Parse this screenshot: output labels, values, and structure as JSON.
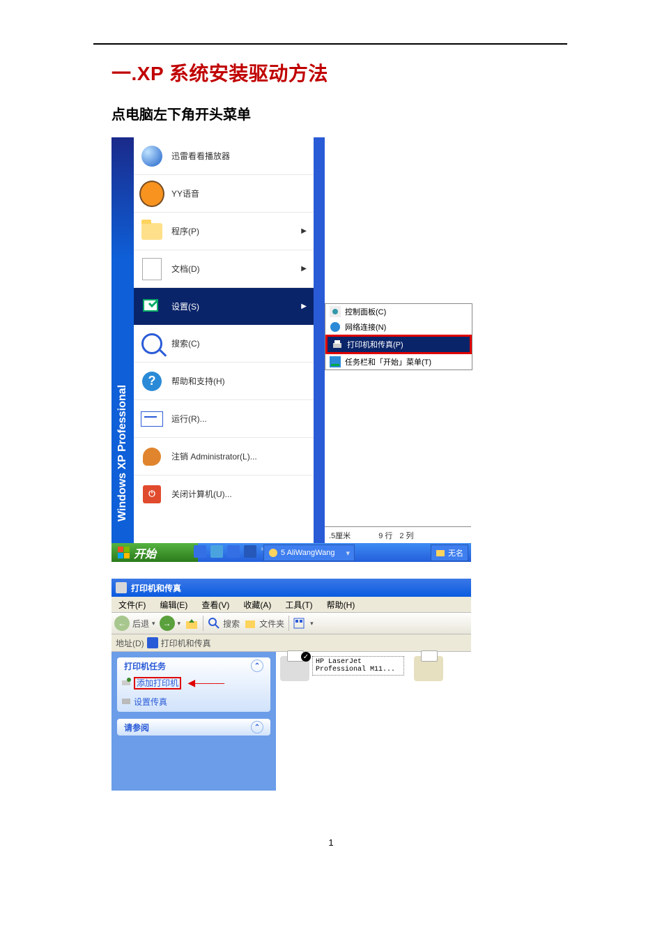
{
  "doc": {
    "title": "一.XP 系统安装驱动方法",
    "subtitle": "点电脑左下角开头菜单",
    "page_number": "1"
  },
  "start_menu": {
    "sidebar_text": "Windows XP  Professional",
    "items": [
      {
        "label": "迅雷看看播放器",
        "icon": "xunlei-icon"
      },
      {
        "label": "YY语音",
        "icon": "yy-icon"
      },
      {
        "label": "程序(P)",
        "icon": "programs-folder-icon",
        "arrow": true
      },
      {
        "label": "文档(D)",
        "icon": "documents-icon",
        "arrow": true
      },
      {
        "label": "设置(S)",
        "icon": "settings-icon",
        "arrow": true,
        "highlighted": true
      },
      {
        "label": "搜索(C)",
        "icon": "search-icon"
      },
      {
        "label": "帮助和支持(H)",
        "icon": "help-icon"
      },
      {
        "label": "运行(R)...",
        "icon": "run-icon"
      },
      {
        "label": "注销 Administrator(L)...",
        "icon": "logoff-key-icon"
      },
      {
        "label": "关闭计算机(U)...",
        "icon": "shutdown-icon"
      }
    ],
    "submenu": [
      {
        "label": "控制面板(C)",
        "icon": "control-panel-icon"
      },
      {
        "label": "网络连接(N)",
        "icon": "network-icon"
      },
      {
        "label": "打印机和传真(P)",
        "icon": "printer-icon",
        "selected": true,
        "highlighted_red": true
      },
      {
        "label": "任务栏和「开始」菜单(T)",
        "icon": "taskbar-settings-icon"
      }
    ],
    "status_bar": {
      "text1": ".5厘米",
      "text2": "9 行",
      "text3": "2 列"
    },
    "taskbar": {
      "start": "开始",
      "task1": "5 AliWangWang",
      "task2": "无名"
    }
  },
  "printer_window": {
    "title": "打印机和传真",
    "menu": [
      "文件(F)",
      "编辑(E)",
      "查看(V)",
      "收藏(A)",
      "工具(T)",
      "帮助(H)"
    ],
    "toolbar": {
      "back": "后退",
      "search": "搜索",
      "folders": "文件夹"
    },
    "address": {
      "label": "地址(D)",
      "value": "打印机和传真"
    },
    "panel1": {
      "title": "打印机任务",
      "links": [
        {
          "label": "添加打印机",
          "highlighted_red": true
        },
        {
          "label": "设置传真"
        }
      ]
    },
    "panel2": {
      "title": "请参阅"
    },
    "printers": [
      {
        "name": "HP LaserJet Professional M11...",
        "default": true
      }
    ]
  }
}
